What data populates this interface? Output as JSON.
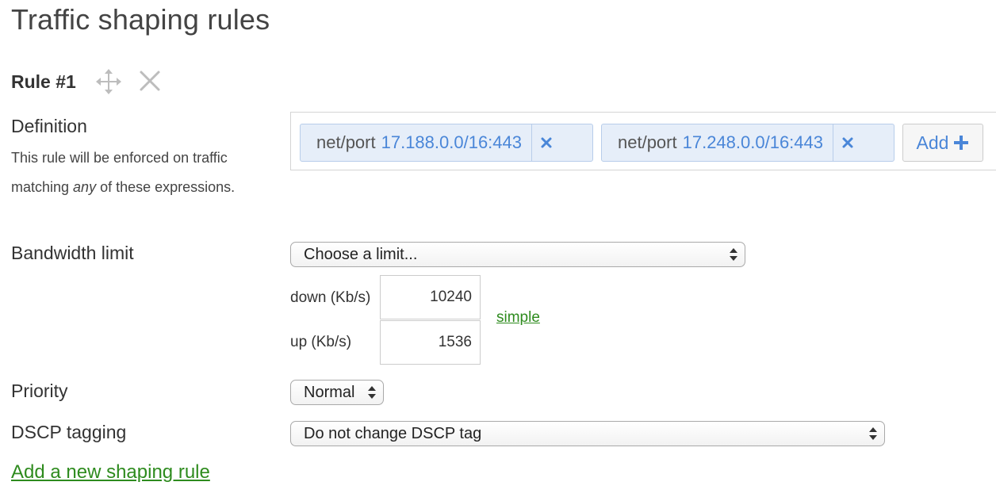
{
  "page_title": "Traffic shaping rules",
  "rule": {
    "title": "Rule #1",
    "icons": {
      "move": "move-icon",
      "delete": "close-icon"
    },
    "definition": {
      "label": "Definition",
      "help_before": "This rule will be enforced on traffic matching ",
      "help_emphasis": "any",
      "help_after": " of these expressions.",
      "expressions": [
        {
          "type": "net/port",
          "value": "17.188.0.0/16:443"
        },
        {
          "type": "net/port",
          "value": "17.248.0.0/16:443"
        }
      ],
      "add_label": "Add"
    },
    "bandwidth": {
      "label": "Bandwidth limit",
      "select_value": "Choose a limit...",
      "down_label": "down (Kb/s)",
      "down_value": "10240",
      "up_label": "up (Kb/s)",
      "up_value": "1536",
      "simple_link": "simple"
    },
    "priority": {
      "label": "Priority",
      "select_value": "Normal"
    },
    "dscp": {
      "label": "DSCP tagging",
      "select_value": "Do not change DSCP tag"
    }
  },
  "add_rule_link": "Add a new shaping rule",
  "colors": {
    "link_green": "#2e8b1e",
    "tag_blue_text": "#4a86d8",
    "tag_background": "#e6eef9",
    "tag_border": "#b8cdea"
  }
}
